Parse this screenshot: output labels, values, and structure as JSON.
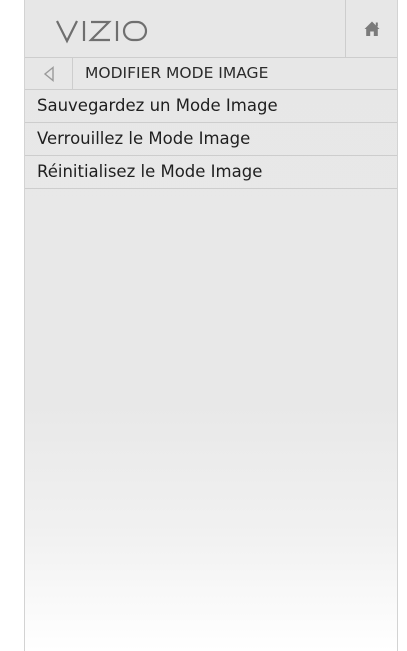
{
  "header": {
    "brand": "VIZIO",
    "home_icon": "home-icon"
  },
  "titlebar": {
    "back_icon": "back-arrow-icon",
    "title": "MODIFIER MODE IMAGE"
  },
  "menu": {
    "items": [
      {
        "label": "Sauvegardez un Mode Image"
      },
      {
        "label": "Verrouillez le Mode Image"
      },
      {
        "label": "Réinitialisez le Mode Image"
      }
    ]
  },
  "colors": {
    "panel_background": "#e8e8e8",
    "divider": "#cdcdcd",
    "text": "#1f1f1f",
    "icon": "#8a8a8a"
  }
}
